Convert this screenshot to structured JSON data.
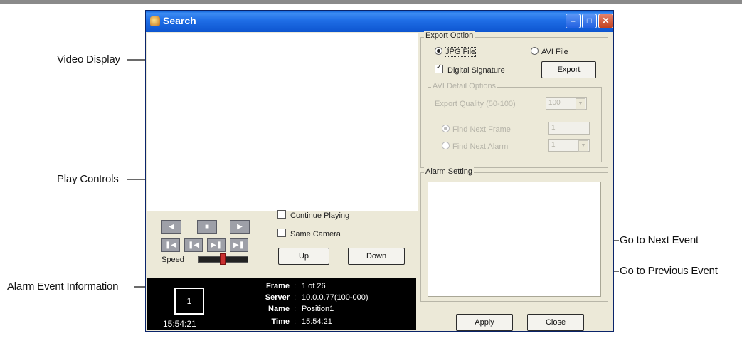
{
  "callouts": {
    "video_display": "Video Display",
    "play_controls": "Play Controls",
    "alarm_event_information": "Alarm Event Information",
    "go_next": "Go to Next Event",
    "go_previous": "Go to Previous Event"
  },
  "window": {
    "title": "Search"
  },
  "controls": {
    "speed_label": "Speed",
    "speed_value": 0.45,
    "continue_playing": "Continue Playing",
    "same_camera": "Same Camera",
    "up": "Up",
    "down": "Down"
  },
  "info": {
    "frame_box": "1",
    "time_big": "15:54:21",
    "labels": {
      "frame": "Frame",
      "server": "Server",
      "name": "Name",
      "time": "Time"
    },
    "values": {
      "frame": "1 of 26",
      "server": "10.0.0.77(100-000)",
      "name": "Position1",
      "time": "15:54:21"
    }
  },
  "export_option": {
    "title": "Export Option",
    "jpg": "JPG File",
    "avi": "AVI File",
    "digital_signature": "Digital Signature",
    "export_button": "Export",
    "avi_detail_title": "AVI Detail Options",
    "export_quality_label": "Export Quality (50-100)",
    "export_quality_value": "100",
    "find_next_frame": "Find Next Frame",
    "find_next_frame_value": "1",
    "find_next_alarm": "Find Next Alarm",
    "find_next_alarm_value": "1"
  },
  "alarm_setting": {
    "title": "Alarm Setting"
  },
  "footer": {
    "apply": "Apply",
    "close": "Close"
  }
}
